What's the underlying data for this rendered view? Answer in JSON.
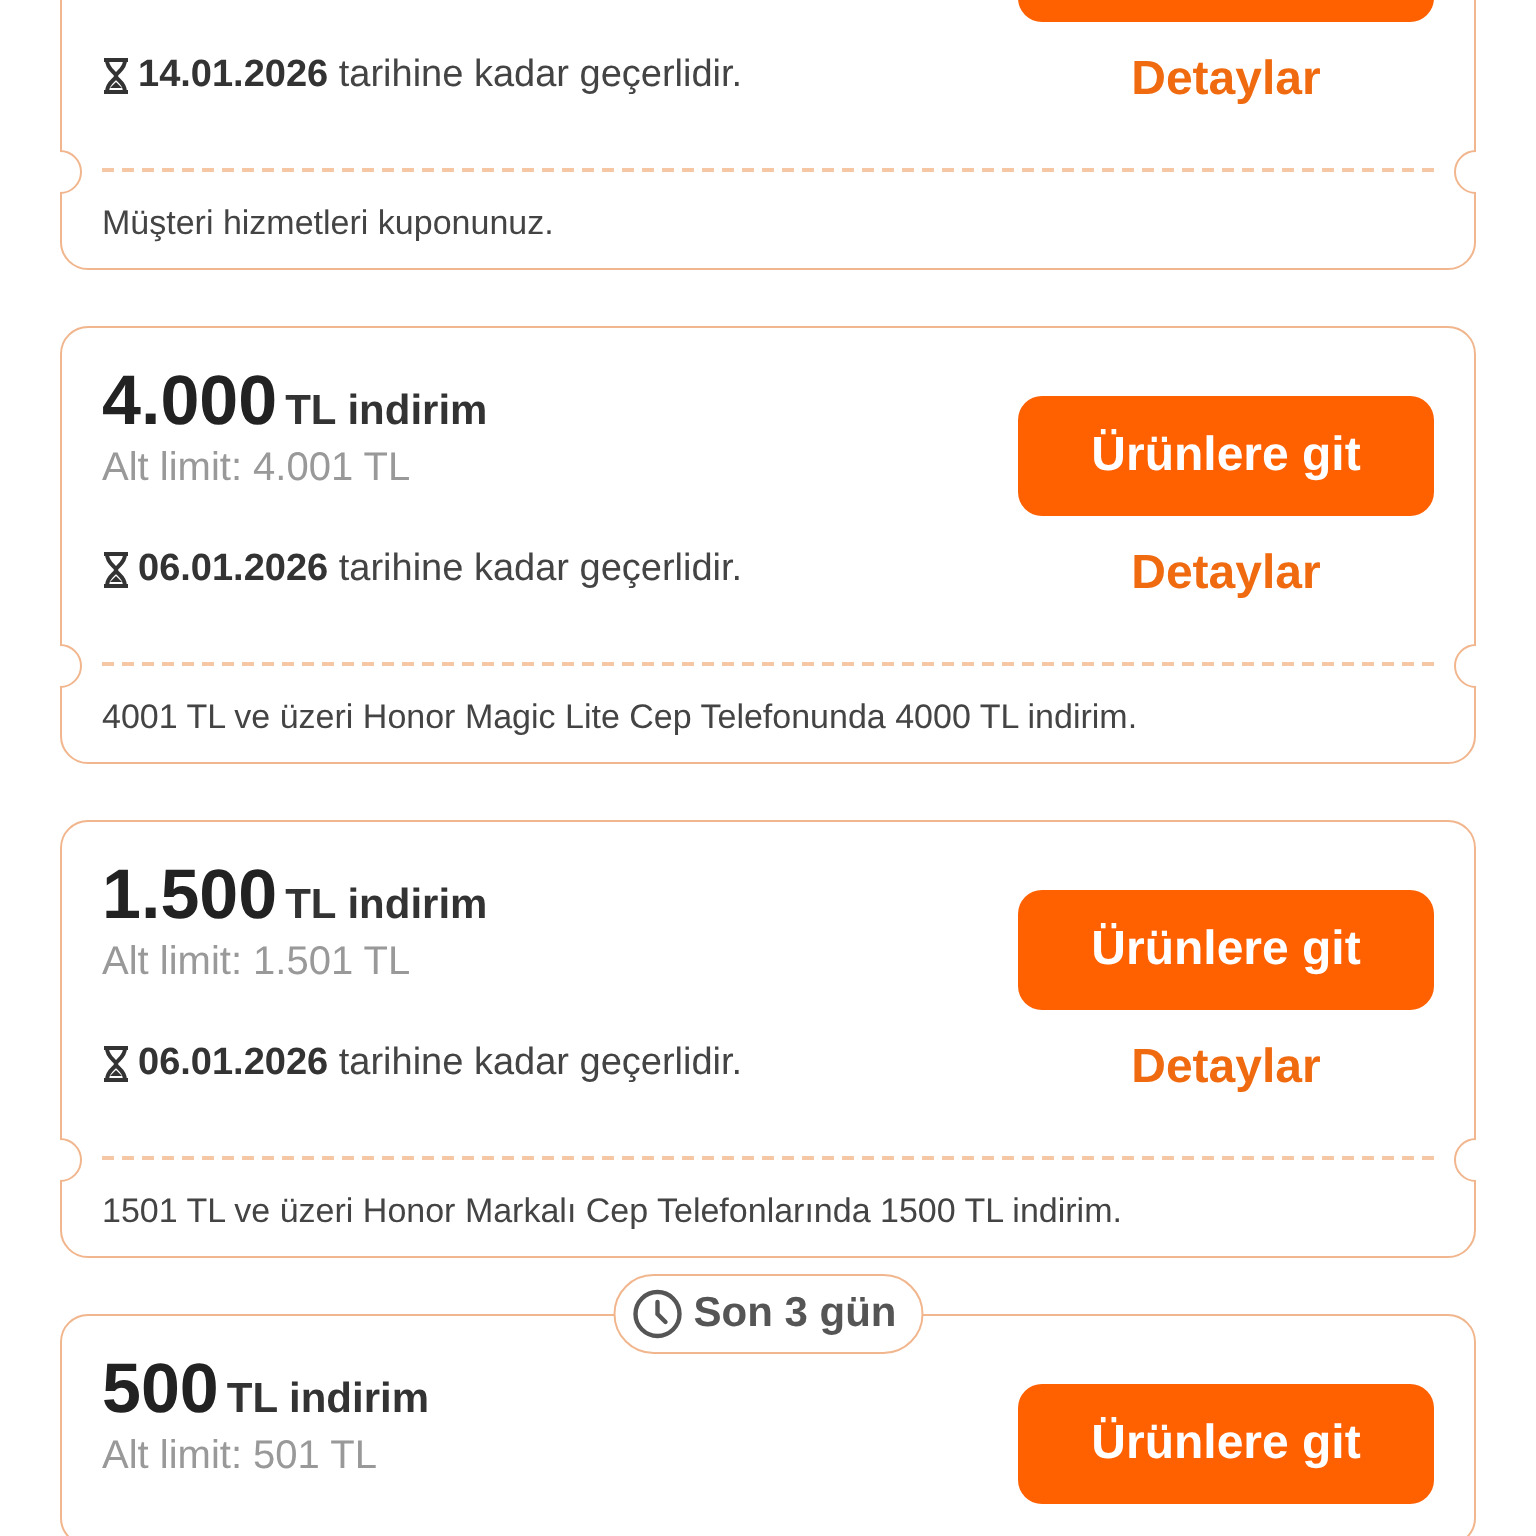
{
  "coupons": [
    {
      "kind": "cut_off",
      "expiry_date": "14.01.2026",
      "expiry_suffix": "tarihine kadar geçerlidir.",
      "details_label": "Detaylar",
      "description": "Müşteri hizmetleri kuponunuz."
    },
    {
      "kind": "full",
      "amount": "4.000",
      "amount_suffix": "TL indirim",
      "min_limit": "Alt limit: 4.001 TL",
      "button": {
        "label": "Ürünlere git"
      },
      "expiry_date": "06.01.2026",
      "expiry_suffix": "tarihine kadar geçerlidir.",
      "details_label": "Detaylar",
      "description": "4001 TL ve üzeri Honor Magic Lite Cep Telefonunda 4000 TL indirim."
    },
    {
      "kind": "full",
      "amount": "1.500",
      "amount_suffix": "TL indirim",
      "min_limit": "Alt limit: 1.501 TL",
      "button": {
        "label": "Ürünlere git"
      },
      "expiry_date": "06.01.2026",
      "expiry_suffix": "tarihine kadar geçerlidir.",
      "details_label": "Detaylar",
      "description": "1501 TL ve üzeri Honor Markalı Cep Telefonlarında 1500 TL indirim."
    },
    {
      "kind": "full",
      "badge": "Son 3 gün",
      "amount": "500",
      "amount_suffix": "TL indirim",
      "min_limit": "Alt limit: 501 TL",
      "button": {
        "label": "Ürünlere git"
      }
    }
  ]
}
